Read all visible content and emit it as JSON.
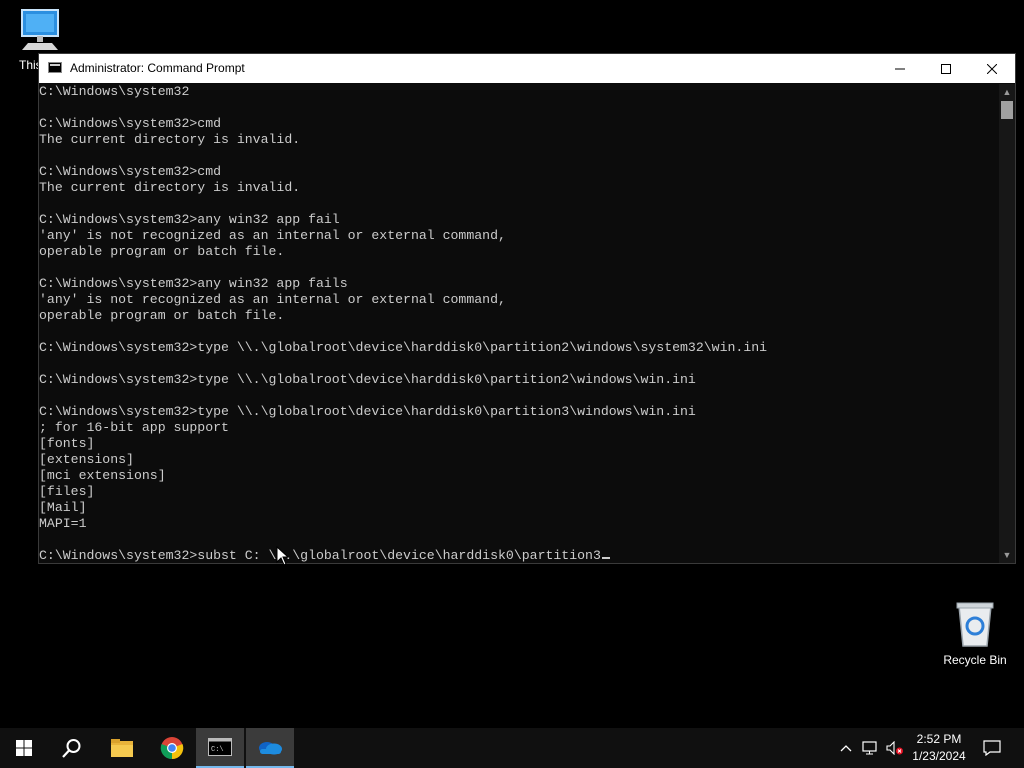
{
  "desktop": {
    "this_pc_label": "This",
    "recycle_bin_label": "Recycle Bin"
  },
  "window": {
    "title": "Administrator: Command Prompt",
    "icons": {
      "app": "cmd-app-icon",
      "minimize": "minimize-icon",
      "maximize": "maximize-icon",
      "close": "close-icon"
    }
  },
  "console": {
    "lines": [
      "C:\\Windows\\system32",
      "",
      "C:\\Windows\\system32>cmd",
      "The current directory is invalid.",
      "",
      "C:\\Windows\\system32>cmd",
      "The current directory is invalid.",
      "",
      "C:\\Windows\\system32>any win32 app fail",
      "'any' is not recognized as an internal or external command,",
      "operable program or batch file.",
      "",
      "C:\\Windows\\system32>any win32 app fails",
      "'any' is not recognized as an internal or external command,",
      "operable program or batch file.",
      "",
      "C:\\Windows\\system32>type \\\\.\\globalroot\\device\\harddisk0\\partition2\\windows\\system32\\win.ini",
      "",
      "C:\\Windows\\system32>type \\\\.\\globalroot\\device\\harddisk0\\partition2\\windows\\win.ini",
      "",
      "C:\\Windows\\system32>type \\\\.\\globalroot\\device\\harddisk0\\partition3\\windows\\win.ini",
      "; for 16-bit app support",
      "[fonts]",
      "[extensions]",
      "[mci extensions]",
      "[files]",
      "[Mail]",
      "MAPI=1",
      "",
      "C:\\Windows\\system32>subst C: \\\\.\\globalroot\\device\\harddisk0\\partition3"
    ],
    "colors": {
      "background": "#0c0c0c",
      "text": "#cccccc"
    }
  },
  "taskbar": {
    "items": [
      "start-icon",
      "search-icon",
      "file-explorer-icon",
      "chrome-icon",
      "command-prompt-icon",
      "onedrive-icon"
    ],
    "tray": [
      "chevron-up-icon",
      "network-icon",
      "volume-muted-icon",
      "notifications-icon"
    ],
    "clock": {
      "time": "2:52 PM",
      "date": "1/23/2024"
    },
    "accent": "#76b9ed"
  }
}
